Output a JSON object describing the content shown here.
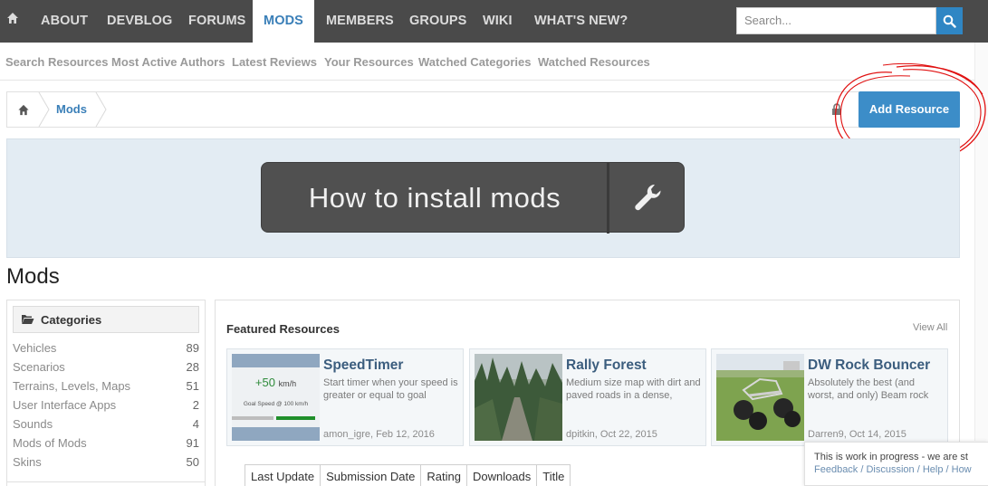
{
  "topnav": {
    "items": [
      "ABOUT",
      "DEVBLOG",
      "FORUMS",
      "MODS",
      "MEMBERS",
      "GROUPS",
      "WIKI",
      "WHAT'S NEW?"
    ],
    "active": "MODS",
    "search_placeholder": "Search..."
  },
  "subnav": {
    "items": [
      "Search Resources",
      "Most Active Authors",
      "Latest Reviews",
      "Your Resources",
      "Watched Categories",
      "Watched Resources"
    ]
  },
  "breadcrumb": {
    "current": "Mods"
  },
  "add_resource_label": "Add Resource",
  "banner": {
    "text": "How to install mods",
    "icon": "wrench-icon"
  },
  "page_title": "Mods",
  "categories": {
    "heading": "Categories",
    "items": [
      {
        "label": "Vehicles",
        "count": "89"
      },
      {
        "label": "Scenarios",
        "count": "28"
      },
      {
        "label": "Terrains, Levels, Maps",
        "count": "51"
      },
      {
        "label": "User Interface Apps",
        "count": "2"
      },
      {
        "label": "Sounds",
        "count": "4"
      },
      {
        "label": "Mods of Mods",
        "count": "91"
      },
      {
        "label": "Skins",
        "count": "50"
      }
    ]
  },
  "featured": {
    "title": "Featured Resources",
    "view_all": "View All",
    "cards": [
      {
        "title": "SpeedTimer",
        "desc": "Start timer when your speed is greater or equal to goal",
        "meta": "amon_igre, Feb 12, 2016",
        "thumb_value": "+50",
        "thumb_unit": "km/h",
        "thumb_caption": "Goal Speed @ 100 km/h"
      },
      {
        "title": "Rally Forest",
        "desc": "Medium size map with dirt and paved roads in a dense,",
        "meta": "dpitkin, Oct 22, 2015"
      },
      {
        "title": "DW Rock Bouncer",
        "desc": "Absolutely the best (and worst, and only) Beam rock",
        "meta": "Darren9, Oct 14, 2015"
      }
    ]
  },
  "sort_tabs": [
    "Last Update",
    "Submission Date",
    "Rating",
    "Downloads",
    "Title"
  ],
  "notice": {
    "text": "This is work in progress - we are st",
    "links": "Feedback / Discussion / Help / How"
  },
  "colors": {
    "nav_bg": "#4a4a4a",
    "accent": "#3c8dc8",
    "annotation": "#e01010"
  }
}
